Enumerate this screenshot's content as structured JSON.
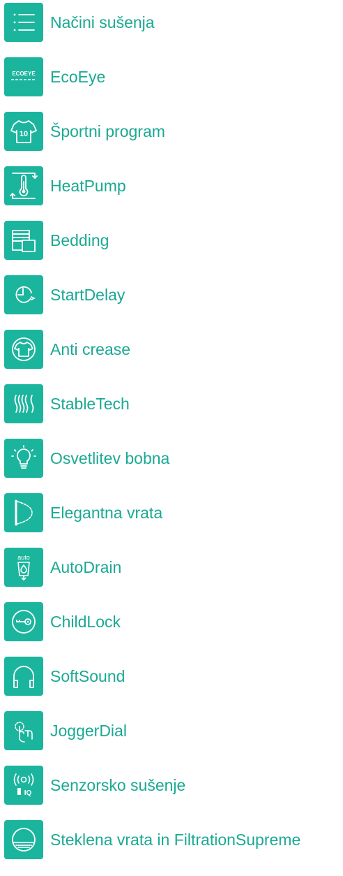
{
  "theme": {
    "accent": "#1bb59e",
    "text_color": "#1aa993",
    "background": "#ffffff"
  },
  "features": [
    {
      "label": "Načini sušenja",
      "icon": "list-icon"
    },
    {
      "label": "EcoEye",
      "icon": "ecoeye-icon",
      "icon_text": "ECOEYE"
    },
    {
      "label": "Športni program",
      "icon": "sports-shirt-icon",
      "icon_text": "10"
    },
    {
      "label": "HeatPump",
      "icon": "thermometer-icon"
    },
    {
      "label": "Bedding",
      "icon": "bedding-icon"
    },
    {
      "label": "StartDelay",
      "icon": "clock-icon"
    },
    {
      "label": "Anti crease",
      "icon": "shirt-icon"
    },
    {
      "label": "StableTech",
      "icon": "stabletech-icon"
    },
    {
      "label": "Osvetlitev bobna",
      "icon": "lightbulb-icon"
    },
    {
      "label": "Elegantna vrata",
      "icon": "door-icon"
    },
    {
      "label": "AutoDrain",
      "icon": "autodrain-icon",
      "icon_text": "auto"
    },
    {
      "label": "ChildLock",
      "icon": "key-icon"
    },
    {
      "label": "SoftSound",
      "icon": "headphones-icon"
    },
    {
      "label": "JoggerDial",
      "icon": "jogger-dial-icon"
    },
    {
      "label": "Senzorsko sušenje",
      "icon": "sensor-icon",
      "icon_text": "IQ"
    },
    {
      "label": "Steklena vrata in FiltrationSupreme",
      "icon": "glass-door-icon"
    }
  ]
}
